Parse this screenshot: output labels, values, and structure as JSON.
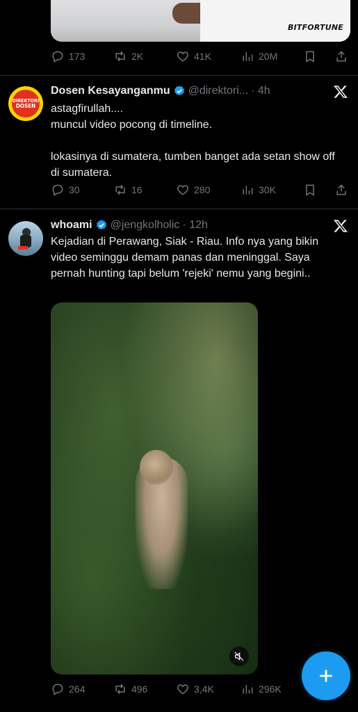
{
  "tweets": [
    {
      "media_brand": "BITFORTUNE",
      "stats": {
        "replies": "173",
        "retweets": "2K",
        "likes": "41K",
        "views": "20M"
      }
    },
    {
      "name": "Dosen Kesayanganmu",
      "handle": "@direktori...",
      "time": "· 4h",
      "avatar_text_line1": "DIREKTORI",
      "avatar_text_line2": "DOSEN",
      "text": "astagfirullah....\nmuncul video pocong di timeline.\n\nlokasinya di sumatera, tumben banget ada setan show off di sumatera.",
      "stats": {
        "replies": "30",
        "retweets": "16",
        "likes": "280",
        "views": "30K"
      }
    },
    {
      "name": "whoami",
      "handle": "@jengkolholic",
      "time": "· 12h",
      "text": "Kejadian di Perawang, Siak - Riau. Info nya yang bikin video seminggu demam panas dan meninggal. Saya pernah hunting tapi belum 'rejeki' nemu yang begini..",
      "stats": {
        "replies": "264",
        "retweets": "496",
        "likes": "3,4K",
        "views": "296K"
      }
    }
  ],
  "colors": {
    "accent": "#1d9bf0",
    "muted": "#71767b",
    "background": "#000000",
    "divider": "#2f3336"
  }
}
